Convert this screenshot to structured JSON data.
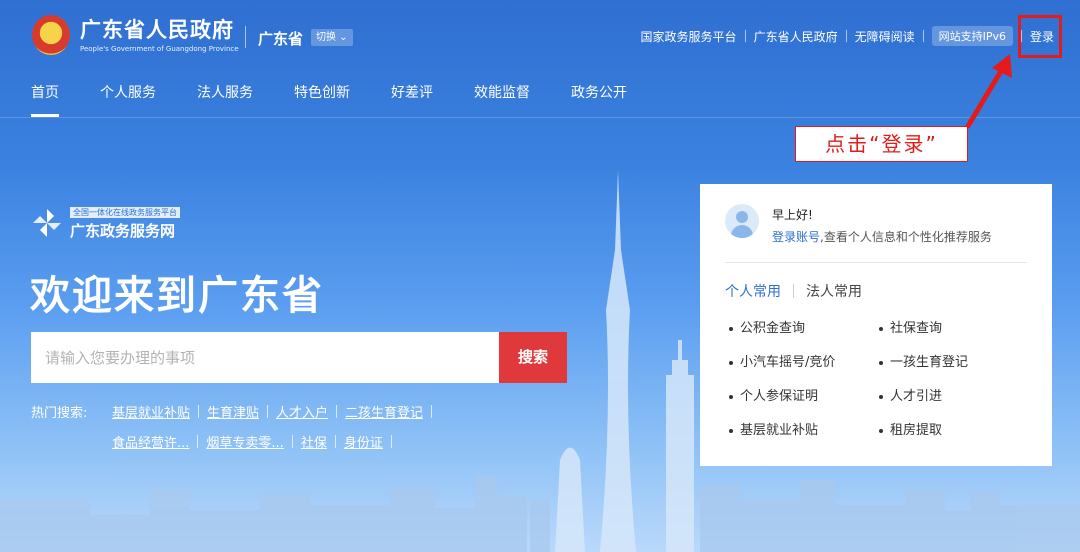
{
  "header": {
    "title": "广东省人民政府",
    "subtitle": "People's Government of Guangdong Province",
    "region": "广东省",
    "switch_label": "切换",
    "links": [
      "国家政务服务平台",
      "广东省人民政府",
      "无障碍阅读"
    ],
    "ipv6_badge": "网站支持IPv6",
    "login": "登录"
  },
  "nav": {
    "items": [
      "首页",
      "个人服务",
      "法人服务",
      "特色创新",
      "好差评",
      "效能监督",
      "政务公开"
    ]
  },
  "annotation": {
    "callout": "点击“登录”"
  },
  "hero": {
    "portal_tag": "全国一体化在线政务服务平台",
    "portal_name": "广东政务服务网",
    "welcome": "欢迎来到广东省",
    "search_placeholder": "请输入您要办理的事项",
    "search_button": "搜索",
    "hot_label": "热门搜索:",
    "hot_row1": [
      "基层就业补贴",
      "生育津贴",
      "人才入户",
      "二孩生育登记"
    ],
    "hot_row2": [
      "食品经营许...",
      "烟草专卖零...",
      "社保",
      "身份证"
    ]
  },
  "panel": {
    "greeting": "早上好!",
    "login_account": "登录账号",
    "greeting_desc": ",查看个人信息和个性化推荐服务",
    "tab_personal": "个人常用",
    "tab_legal": "法人常用",
    "services": [
      "公积金查询",
      "社保查询",
      "小汽车摇号/竞价",
      "一孩生育登记",
      "个人参保证明",
      "人才引进",
      "基层就业补贴",
      "租房提取"
    ]
  },
  "colors": {
    "brand_blue": "#2f6fd1",
    "search_red": "#e0393b",
    "annotation_red": "#e31b1b"
  }
}
